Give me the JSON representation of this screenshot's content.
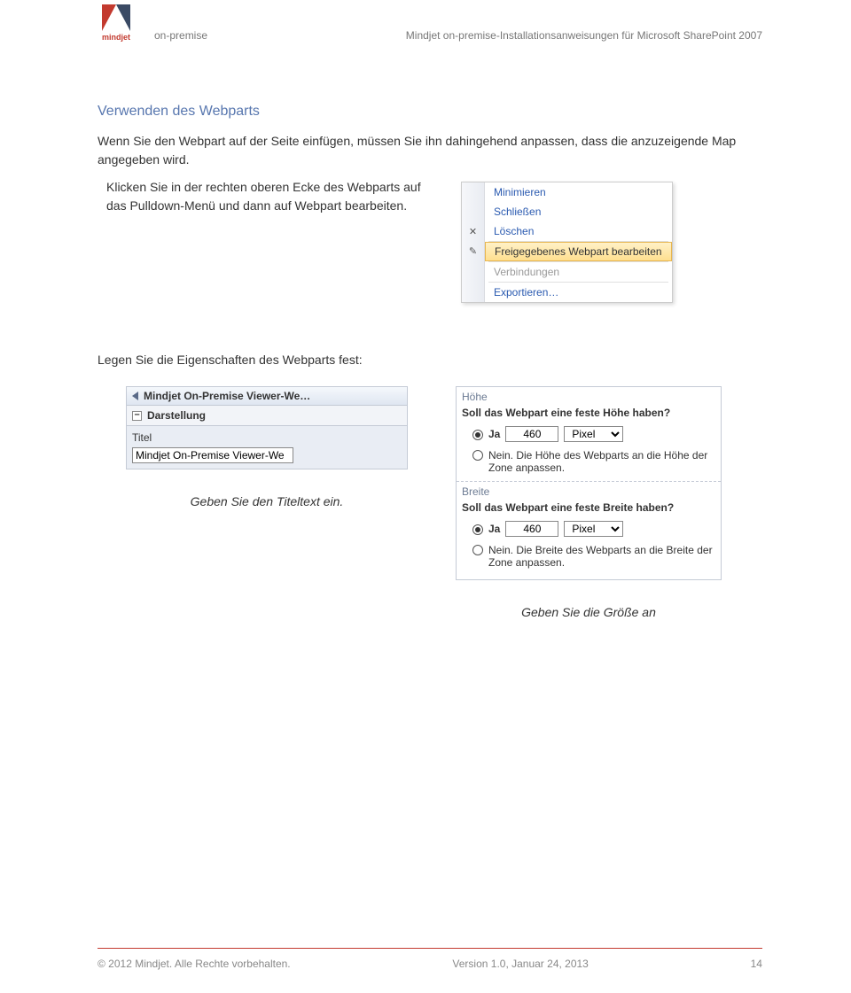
{
  "header": {
    "brand_word": "mindjet",
    "left": "on-premise",
    "right": "Mindjet on-premise-Installationsanweisungen für Microsoft SharePoint 2007"
  },
  "section": {
    "title": "Verwenden des Webparts",
    "p1": "Wenn Sie den Webpart auf der Seite einfügen, müssen Sie ihn dahingehend anpassen, dass die anzuzeigende Map angegeben wird.",
    "p2": "Klicken Sie in der rechten oberen Ecke des Webparts auf das Pulldown-Menü und dann auf Webpart bearbeiten."
  },
  "context_menu": {
    "items": [
      {
        "label": "Minimieren",
        "state": "normal"
      },
      {
        "label": "Schließen",
        "state": "normal"
      },
      {
        "label": "Löschen",
        "state": "normal",
        "icon": "✕"
      },
      {
        "label": "Freigegebenes Webpart bearbeiten",
        "state": "hover",
        "icon": "✎"
      },
      {
        "label": "Verbindungen",
        "state": "disabled"
      },
      {
        "label": "Exportieren…",
        "state": "normal"
      }
    ]
  },
  "below_label": "Legen Sie die Eigenschaften des Webparts fest:",
  "title_panel": {
    "header": "Mindjet On-Premise Viewer-We…",
    "group": "Darstellung",
    "field_label": "Titel",
    "value": "Mindjet On-Premise Viewer-We",
    "caption": "Geben Sie den Titeltext ein."
  },
  "size_panel": {
    "height_label": "Höhe",
    "height_question": "Soll das Webpart eine feste Höhe haben?",
    "ja": "Ja",
    "height_value": "460",
    "unit": "Pixel",
    "height_no": "Nein. Die Höhe des Webparts an die Höhe der Zone anpassen.",
    "width_label": "Breite",
    "width_question": "Soll das Webpart eine feste Breite haben?",
    "width_value": "460",
    "width_no": "Nein. Die Breite des Webparts an die Breite der Zone anpassen.",
    "caption": "Geben Sie die Größe an"
  },
  "footer": {
    "left": "© 2012 Mindjet. Alle Rechte vorbehalten.",
    "mid": "Version 1.0, Januar 24, 2013",
    "right": "14"
  }
}
